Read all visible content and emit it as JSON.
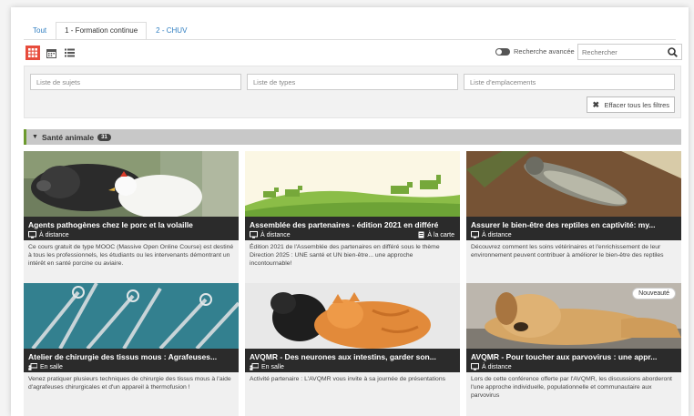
{
  "tabs": [
    {
      "label": "Tout"
    },
    {
      "label": "1 - Formation continue"
    },
    {
      "label": "2 - CHUV"
    }
  ],
  "search": {
    "advanced_label": "Recherche avancée",
    "placeholder": "Rechercher"
  },
  "filters": {
    "subjects_placeholder": "Liste de sujets",
    "types_placeholder": "Liste de types",
    "locations_placeholder": "Liste d'emplacements",
    "clear_label": "Effacer tous les filtres"
  },
  "section": {
    "title": "Santé animale",
    "count": "31"
  },
  "colors": {
    "accent": "#e74c3c",
    "section_border": "#6c9a2e",
    "card_bar": "#2b2b2b",
    "link": "#2f7ec1"
  },
  "cards": [
    {
      "title": "Agents pathogènes chez le porc et la volaille",
      "mode": "À distance",
      "mode_icon": "monitor-icon",
      "desc": "Ce cours gratuit de type MOOC (Massive Open Online Course) est destiné à tous les professionnels, les étudiants ou les intervenants démontrant un intérêt en santé porcine ou aviaire."
    },
    {
      "title": "Assemblée des partenaires - édition 2021 en différé",
      "mode": "À distance",
      "mode_icon": "monitor-icon",
      "extra": "À la carte",
      "extra_icon": "document-icon",
      "desc": "Édition 2021 de l'Assemblée des partenaires en différé sous le thème Direction 2025 : UNE santé et UN bien-être... une approche incontournable!"
    },
    {
      "title": "Assurer le bien-être des reptiles en captivité: my...",
      "mode": "À distance",
      "mode_icon": "monitor-icon",
      "desc": "Découvrez comment les soins vétérinaires et l'enrichissement de leur environnement peuvent contribuer à améliorer le bien-être des reptiles"
    },
    {
      "title": "Atelier de chirurgie des tissus mous : Agrafeuses...",
      "mode": "En salle",
      "mode_icon": "classroom-icon",
      "desc": "Venez pratiquer plusieurs techniques de chirurgie des tissus mous à l'aide d'agrafeuses chirurgicales et d'un appareil à thermofusion !"
    },
    {
      "title": "AVQMR - Des neurones aux intestins, garder son...",
      "mode": "En salle",
      "mode_icon": "classroom-icon",
      "desc": "Activité partenaire : L'AVQMR vous invite à sa journée de présentations"
    },
    {
      "title": "AVQMR - Pour toucher aux parvovirus : une appr...",
      "mode": "À distance",
      "mode_icon": "monitor-icon",
      "badge": "Nouveauté",
      "desc": "Lors de cette conférence offerte par l'AVQMR, les discussions aborderont l'une approche individuelle, populationnelle et communautaire aux parvovirus"
    }
  ]
}
